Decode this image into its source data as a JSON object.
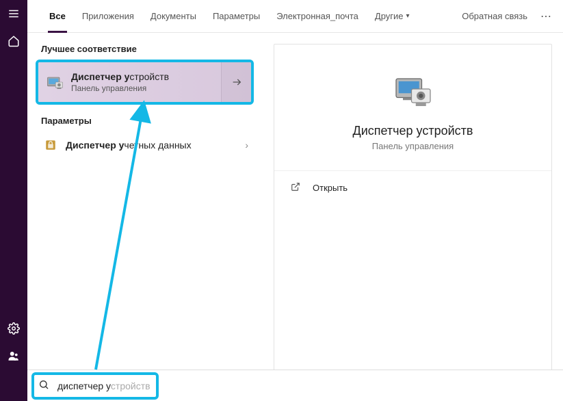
{
  "tabs": {
    "all": "Все",
    "apps": "Приложения",
    "documents": "Документы",
    "settings": "Параметры",
    "email": "Электронная_почта",
    "other": "Другие",
    "feedback": "Обратная связь"
  },
  "sections": {
    "best_match": "Лучшее соответствие",
    "settings": "Параметры"
  },
  "best_match": {
    "title_bold": "Диспетчер у",
    "title_rest": "стройств",
    "subtitle": "Панель управления"
  },
  "results": [
    {
      "title_bold": "Диспетчер у",
      "title_rest": "четных данных"
    }
  ],
  "detail": {
    "title": "Диспетчер устройств",
    "subtitle": "Панель управления",
    "open_label": "Открыть"
  },
  "search": {
    "typed": "диспетчер у",
    "suggestion": "стройств"
  }
}
